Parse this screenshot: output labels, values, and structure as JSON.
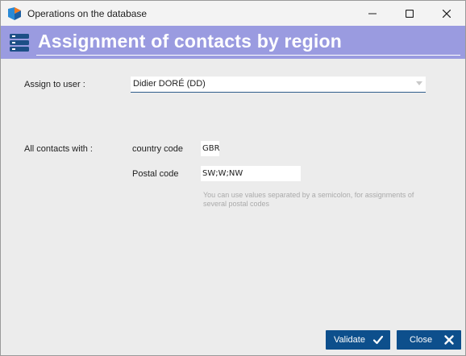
{
  "window": {
    "title": "Operations on the database",
    "controls": {
      "minimize": "minimize-icon",
      "maximize": "maximize-icon",
      "close": "close-icon"
    }
  },
  "header": {
    "title": "Assignment of contacts by region",
    "icon": "database-icon",
    "color": "#9a9be0"
  },
  "form": {
    "assign_label": "Assign to user :",
    "assign_value": "Didier DORÉ (DD)",
    "all_contacts_label": "All contacts with :",
    "country_label": "country code",
    "country_value": "GBR",
    "postal_label": "Postal code",
    "postal_value": "SW;W;NW",
    "hint": "You can use values separated by a semicolon, for assignments of several postal codes"
  },
  "buttons": {
    "validate_label": "Validate",
    "validate_icon": "check-icon",
    "close_label": "Close",
    "close_icon": "x-icon",
    "color": "#0d4f8c"
  }
}
